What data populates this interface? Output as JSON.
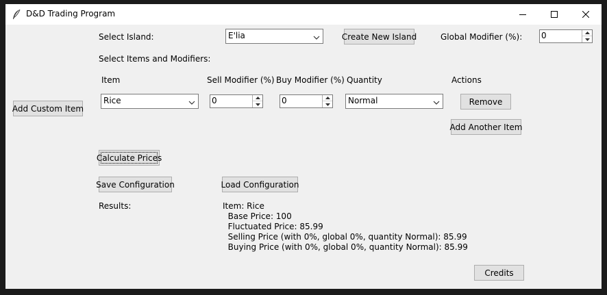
{
  "window": {
    "title": "D&D Trading Program",
    "icon": "feather-icon",
    "controls": [
      "minimize-icon",
      "maximize-icon",
      "close-icon"
    ]
  },
  "island": {
    "label": "Select Island:",
    "selected": "E'lia",
    "create_button": "Create New Island"
  },
  "global_modifier": {
    "label": "Global Modifier (%):",
    "value": "0"
  },
  "items_section": {
    "label": "Select Items and Modifiers:",
    "headers": {
      "item": "Item",
      "sell": "Sell Modifier (%)",
      "buy": "Buy Modifier (%)",
      "quantity": "Quantity",
      "actions": "Actions"
    },
    "rows": [
      {
        "item": "Rice",
        "sell": "0",
        "buy": "0",
        "quantity": "Normal",
        "remove_label": "Remove"
      }
    ],
    "add_another_label": "Add Another Item"
  },
  "add_custom_label": "Add Custom Item",
  "calculate_label": "Calculate Prices",
  "save_label": "Save Configuration",
  "load_label": "Load Configuration",
  "results": {
    "label": "Results:",
    "lines": [
      "Item: Rice",
      "  Base Price: 100",
      "  Fluctuated Price: 85.99",
      "  Selling Price (with 0%, global 0%, quantity Normal): 85.99",
      "  Buying Price (with 0%, global 0%, quantity Normal): 85.99"
    ]
  },
  "credits_label": "Credits"
}
